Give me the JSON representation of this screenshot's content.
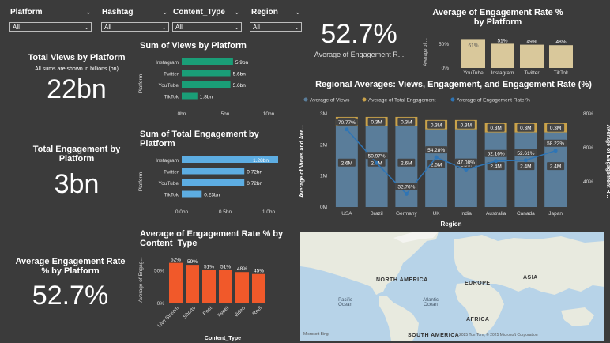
{
  "slicers": [
    {
      "label": "Platform",
      "value": "All"
    },
    {
      "label": "Hashtag",
      "value": "All"
    },
    {
      "label": "Content_Type",
      "value": "All"
    },
    {
      "label": "Region",
      "value": "All"
    }
  ],
  "cards": {
    "views": {
      "title": "Total Views by Platform",
      "subtitle": "All sums are shown in billions (bn)",
      "value": "22bn"
    },
    "engagement": {
      "title": "Total Engagement by Platform",
      "value": "3bn"
    },
    "rate": {
      "title": "Average Engagement Rate % by Platform",
      "value": "52.7%"
    },
    "kpi_top": {
      "value": "52.7%",
      "label": "Average of Engagement R..."
    }
  },
  "colors": {
    "green": "#1a9e77",
    "blue": "#5dade2",
    "orange": "#f1592a",
    "tan": "#d9c89b",
    "steel": "#5a7d9a",
    "gold": "#c9a24a",
    "line": "#2e75b6"
  },
  "chart_data": [
    {
      "id": "views",
      "type": "bar",
      "orientation": "horizontal",
      "title": "Sum of Views by Platform",
      "ylabel": "Platform",
      "categories": [
        "Instagram",
        "Twitter",
        "YouTube",
        "TikTok"
      ],
      "values": [
        5.9,
        5.6,
        5.6,
        1.8
      ],
      "labels": [
        "5.9bn",
        "5.6bn",
        "5.6bn",
        "1.8bn"
      ],
      "xlim": [
        0,
        10
      ],
      "ticks": [
        "0bn",
        "5bn",
        "10bn"
      ]
    },
    {
      "id": "engagement",
      "type": "bar",
      "orientation": "horizontal",
      "title": "Sum of Total Engagement by Platform",
      "ylabel": "Platform",
      "categories": [
        "Instagram",
        "Twitter",
        "YouTube",
        "TikTok"
      ],
      "values": [
        1.28,
        0.72,
        0.72,
        0.23
      ],
      "labels": [
        "1.28bn",
        "0.72bn",
        "0.72bn",
        "0.23bn"
      ],
      "xlim": [
        0,
        1
      ],
      "ticks": [
        "0.0bn",
        "0.5bn",
        "1.0bn"
      ]
    },
    {
      "id": "content",
      "type": "bar",
      "title": "Average of Engagement Rate % by Content_Type",
      "xlabel": "Content_Type",
      "ylabel": "Average of Engag...",
      "categories": [
        "Live Stream",
        "Shorts",
        "Post",
        "Tweet",
        "Video",
        "Reel"
      ],
      "values": [
        62,
        59,
        51,
        51,
        48,
        45
      ],
      "labels": [
        "62%",
        "59%",
        "51%",
        "51%",
        "48%",
        "45%"
      ],
      "ylim": [
        0,
        70
      ],
      "ticks": [
        "0%",
        "50%"
      ]
    },
    {
      "id": "platform_rate",
      "type": "bar",
      "title": "Average of Engagement Rate % by Platform",
      "ylabel": "Average of ...",
      "categories": [
        "YouTube",
        "Instagram",
        "Twitter",
        "TikTok"
      ],
      "values": [
        61,
        51,
        49,
        48
      ],
      "labels": [
        "61%",
        "51%",
        "49%",
        "48%"
      ],
      "ylim": [
        0,
        70
      ],
      "ticks": [
        "0%",
        "50%"
      ]
    },
    {
      "id": "regional",
      "type": "bar",
      "title": "Regional Averages: Views, Engagement, and Engagement Rate (%)",
      "xlabel": "Region",
      "ylabel": "Average of Views and Ave...",
      "y2label": "Average of Engagement R...",
      "legend": [
        "Average of Views",
        "Average of Total Engagement",
        "Average of Engagement Rate %"
      ],
      "categories": [
        "USA",
        "Brazil",
        "Germany",
        "UK",
        "India",
        "Australia",
        "Canada",
        "Japan"
      ],
      "series": [
        {
          "name": "Average of Views",
          "values": [
            2.6,
            2.6,
            2.6,
            2.5,
            2.5,
            2.4,
            2.4,
            2.4
          ],
          "labels": [
            "2.6M",
            "2.6M",
            "2.6M",
            "2.5M",
            "2.5M",
            "2.4M",
            "2.4M",
            "2.4M"
          ]
        },
        {
          "name": "Average of Total Engagement",
          "values": [
            0.3,
            0.3,
            0.3,
            0.3,
            0.3,
            0.3,
            0.3,
            0.3
          ],
          "labels": [
            "0.3M",
            "0.3M",
            "0.3M",
            "0.3M",
            "0.3M",
            "0.3M",
            "0.3M",
            "0.3M"
          ]
        },
        {
          "name": "Average of Engagement Rate %",
          "values": [
            70.77,
            50.97,
            32.76,
            54.28,
            47.08,
            52.16,
            52.61,
            58.23
          ],
          "labels": [
            "70.77%",
            "50.97%",
            "32.76%",
            "54.28%",
            "47.08%",
            "52.16%",
            "52.61%",
            "58.23%"
          ]
        }
      ],
      "ylim": [
        0,
        3
      ],
      "y_ticks": [
        "0M",
        "1M",
        "2M",
        "3M"
      ],
      "y2lim": [
        25,
        80
      ],
      "y2_ticks": [
        "40%",
        "60%",
        "80%"
      ]
    }
  ],
  "map": {
    "labels": [
      "NORTH AMERICA",
      "EUROPE",
      "ASIA",
      "AFRICA",
      "SOUTH AMERICA",
      "Pacific Ocean",
      "Atlantic Ocean"
    ],
    "brand": "Microsoft Bing",
    "copyright": "© 2025 TomTom, © 2025 Microsoft Corporation"
  }
}
